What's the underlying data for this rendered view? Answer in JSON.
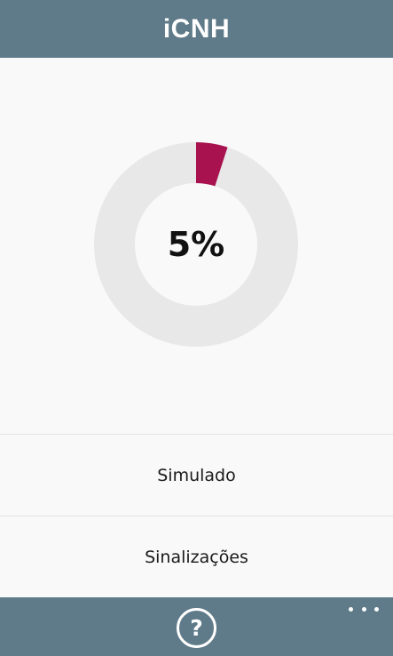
{
  "header": {
    "title": "iCNH"
  },
  "progress": {
    "label": "5%",
    "fraction": 0.05,
    "filled_color": "#a8124e",
    "track_color": "#e8e8e8"
  },
  "menu": {
    "items": [
      {
        "label": "Simulado"
      },
      {
        "label": "Sinalizações"
      }
    ]
  },
  "app_bar": {
    "help_icon": "help-circle-icon",
    "help_glyph": "?",
    "more_icon": "ellipsis-icon",
    "background_color": "#5f7a88"
  }
}
